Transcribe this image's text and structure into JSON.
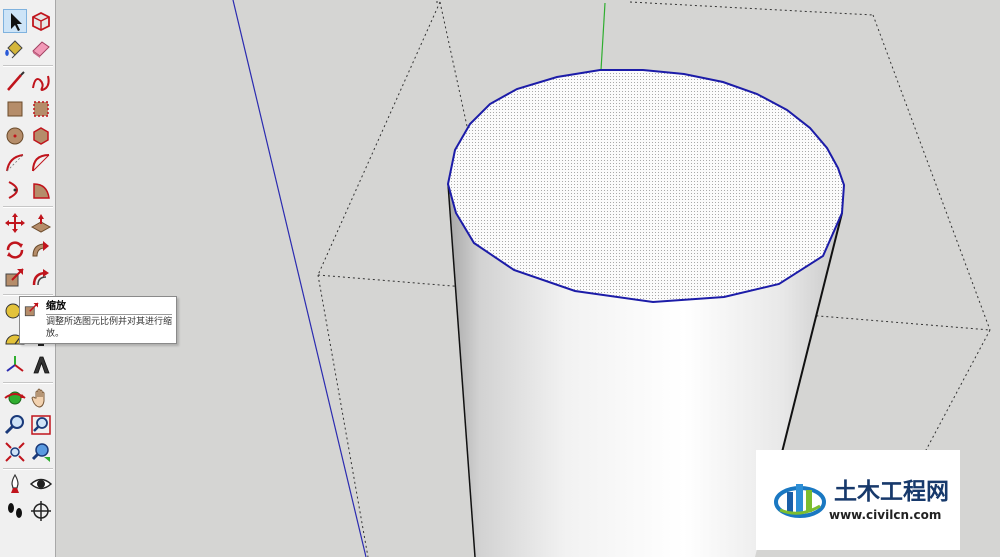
{
  "toolbar": {
    "tools": [
      {
        "name": "select-icon"
      },
      {
        "name": "make-component-icon"
      },
      {
        "name": "paint-bucket-icon"
      },
      {
        "name": "eraser-icon"
      },
      {
        "name": "line-icon"
      },
      {
        "name": "freehand-icon"
      },
      {
        "name": "rectangle-icon"
      },
      {
        "name": "rotated-rectangle-icon"
      },
      {
        "name": "circle-icon"
      },
      {
        "name": "polygon-icon"
      },
      {
        "name": "arc-icon"
      },
      {
        "name": "two-point-arc-icon"
      },
      {
        "name": "three-point-arc-icon"
      },
      {
        "name": "pie-icon"
      },
      {
        "name": "move-icon"
      },
      {
        "name": "push-pull-icon"
      },
      {
        "name": "rotate-icon"
      },
      {
        "name": "follow-me-icon"
      },
      {
        "name": "scale-icon"
      },
      {
        "name": "offset-icon"
      },
      {
        "name": "tape-measure-icon"
      },
      {
        "name": "dimension-icon"
      },
      {
        "name": "protractor-icon"
      },
      {
        "name": "text-icon"
      },
      {
        "name": "axes-icon"
      },
      {
        "name": "3d-text-icon"
      },
      {
        "name": "orbit-icon"
      },
      {
        "name": "pan-icon"
      },
      {
        "name": "zoom-icon"
      },
      {
        "name": "zoom-window-icon"
      },
      {
        "name": "zoom-extents-icon"
      },
      {
        "name": "previous-view-icon"
      },
      {
        "name": "position-camera-icon"
      },
      {
        "name": "look-around-icon"
      },
      {
        "name": "walk-icon"
      },
      {
        "name": "section-plane-icon"
      }
    ]
  },
  "tooltip": {
    "title": "缩放",
    "description": "调整所选图元比例并对其进行缩放。"
  },
  "watermark": {
    "name": "土木工程网",
    "url": "www.civilcn.com"
  },
  "colors": {
    "background": "#d5d5d3",
    "selection_edge": "#1c1ca8",
    "blue_axis": "#2b2bb0",
    "green_axis": "#2fae2f",
    "bounding_box": "#333333"
  }
}
